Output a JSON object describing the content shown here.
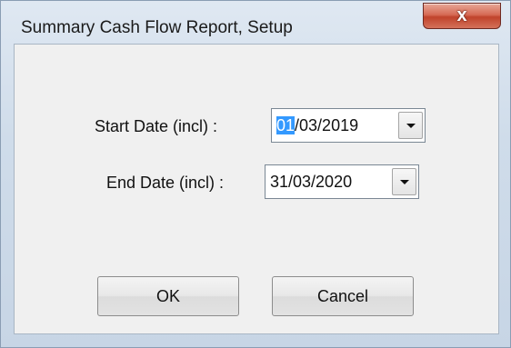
{
  "window": {
    "title": "Summary Cash Flow Report, Setup",
    "close_glyph": "x",
    "close_icon": "close-icon"
  },
  "form": {
    "start_label": "Start Date (incl) :",
    "start_value_selected": "01",
    "start_value_rest": "/03/2019",
    "end_label": "End Date (incl) :",
    "end_value": "31/03/2020",
    "dropdown_icon": "chevron-down-icon"
  },
  "buttons": {
    "ok_label": "OK",
    "cancel_label": "Cancel"
  },
  "colors": {
    "selection": "#3399ff",
    "close_button": "#c0432b",
    "client_background": "#f0f0f0"
  }
}
